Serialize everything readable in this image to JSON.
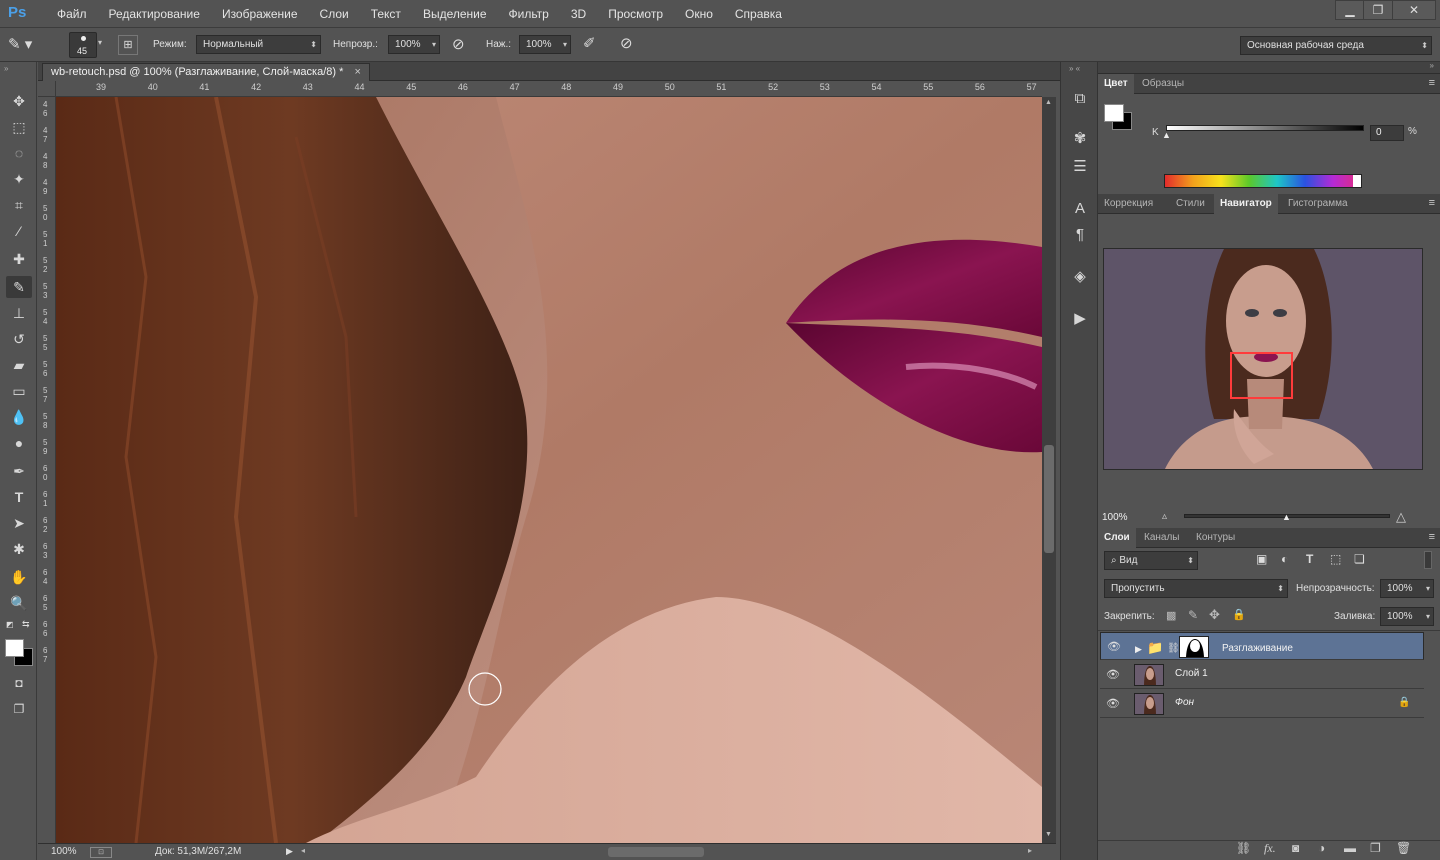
{
  "app": {
    "logo": "Ps"
  },
  "menu": [
    "Файл",
    "Редактирование",
    "Изображение",
    "Слои",
    "Текст",
    "Выделение",
    "Фильтр",
    "3D",
    "Просмотр",
    "Окно",
    "Справка"
  ],
  "window_controls": {
    "minimize": "▁",
    "restore": "❐",
    "close": "✕"
  },
  "options": {
    "brush_size": "45",
    "mode_label": "Режим:",
    "mode_value": "Нормальный",
    "opacity_label": "Непрозр.:",
    "opacity_value": "100%",
    "flow_label": "Наж.:",
    "flow_value": "100%",
    "workspace": "Основная рабочая среда"
  },
  "document": {
    "tab_title": "wb-retouch.psd @ 100% (Разглаживание, Слой-маска/8) *",
    "tab_close": "×",
    "ruler_top": [
      "39",
      "40",
      "41",
      "42",
      "43",
      "44",
      "45",
      "46",
      "47",
      "48",
      "49",
      "50",
      "51",
      "52",
      "53",
      "54",
      "55",
      "56",
      "57"
    ],
    "ruler_left": [
      "46",
      "47",
      "48",
      "49",
      "50",
      "51",
      "52",
      "53",
      "54",
      "55",
      "56",
      "57",
      "58",
      "59",
      "60",
      "61",
      "62",
      "63",
      "64",
      "65",
      "66",
      "67"
    ],
    "status_zoom": "100%",
    "status_doc": "Док: 51,3M/267,2M"
  },
  "color_panel": {
    "tabs": [
      "Цвет",
      "Образцы"
    ],
    "slider_label": "K",
    "slider_value": "0",
    "slider_unit": "%"
  },
  "nav_panel": {
    "tabs": [
      "Коррекция",
      "Стили",
      "Навигатор",
      "Гистограмма"
    ],
    "active_tab": "Навигатор",
    "zoom": "100%"
  },
  "layers_panel": {
    "tabs": [
      "Слои",
      "Каналы",
      "Контуры"
    ],
    "filter_kind": "Вид",
    "blend_mode": "Пропустить",
    "opacity_label": "Непрозрачность:",
    "opacity_value": "100%",
    "lock_label": "Закрепить:",
    "fill_label": "Заливка:",
    "fill_value": "100%",
    "layers": [
      {
        "name": "Разглаживание",
        "type": "group",
        "selected": true
      },
      {
        "name": "Слой 1",
        "type": "pixel",
        "selected": false
      },
      {
        "name": "Фон",
        "type": "background",
        "selected": false,
        "locked": true
      }
    ]
  },
  "colors": {
    "accent": "#4ba0e8",
    "selected_layer": "#5d7395",
    "nav_box": "#ff3b3b"
  }
}
